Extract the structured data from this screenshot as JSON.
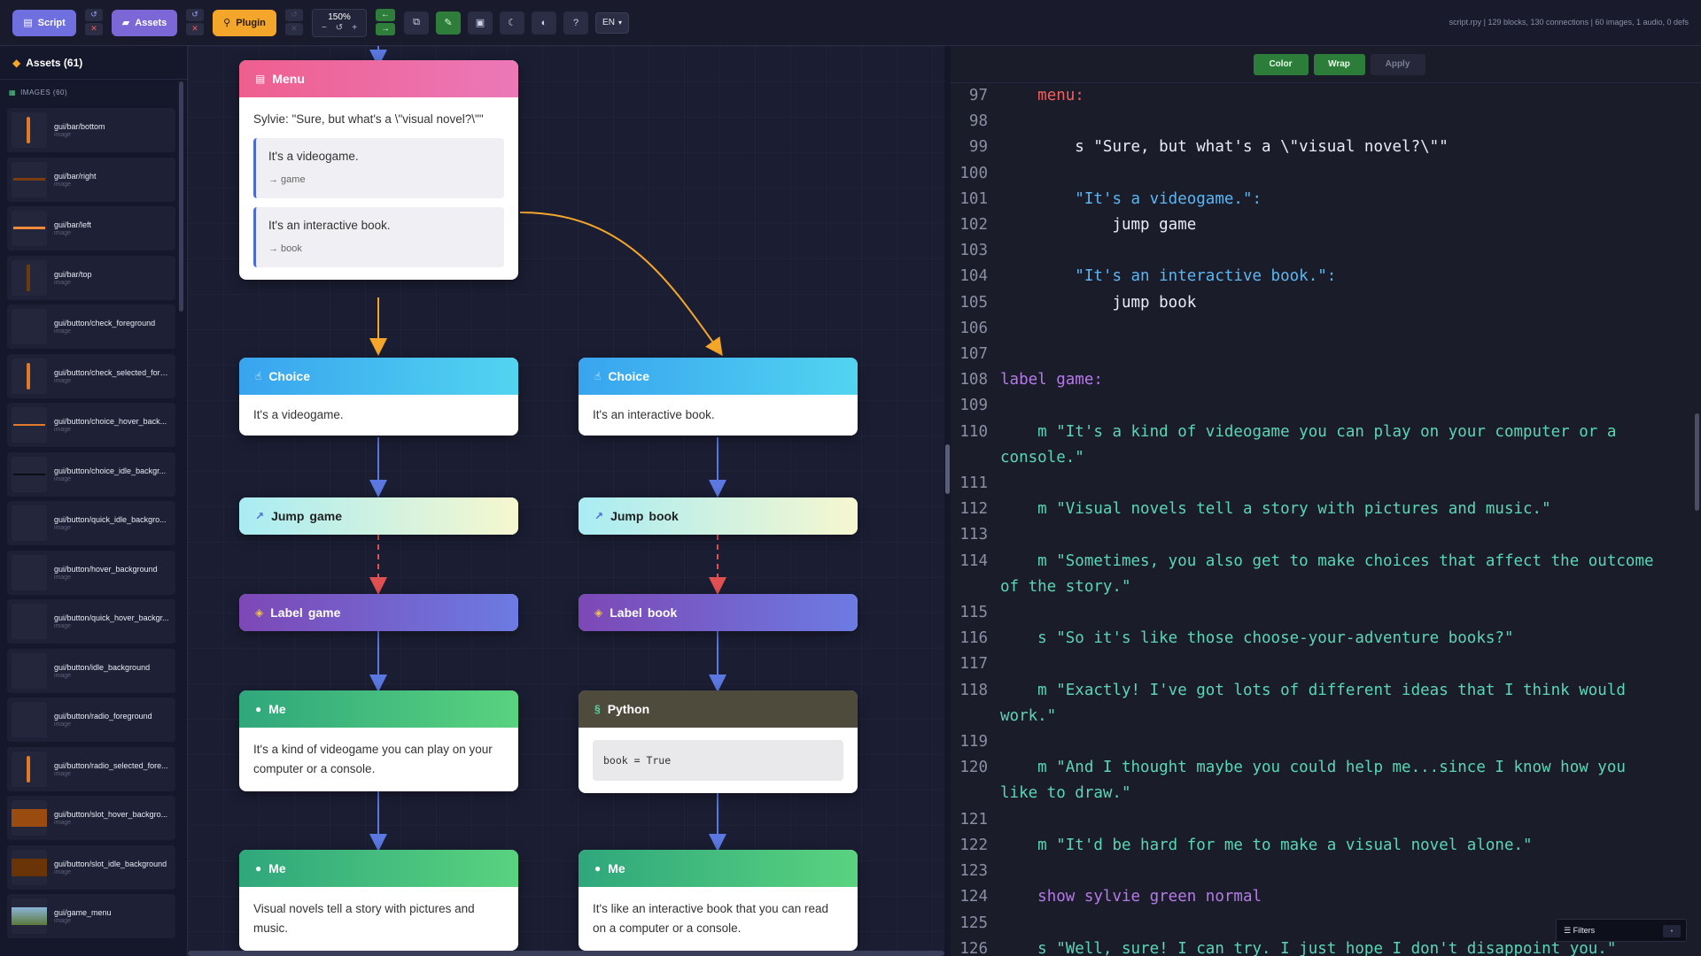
{
  "toolbar": {
    "script_label": "Script",
    "assets_label": "Assets",
    "plugin_label": "Plugin",
    "zoom": "150%",
    "zoom_minus": "−",
    "zoom_reset": "↺",
    "zoom_plus": "+",
    "lang": "EN",
    "help": "?",
    "status": "script.rpy | 129 blocks, 130 connections | 60 images, 1 audio, 0 defs"
  },
  "sidebar": {
    "title": "Assets (61)",
    "section": "IMAGES (60)",
    "assets": [
      {
        "name": "gui/bar/bottom",
        "type": "image"
      },
      {
        "name": "gui/bar/right",
        "type": "image"
      },
      {
        "name": "gui/bar/left",
        "type": "image"
      },
      {
        "name": "gui/bar/top",
        "type": "image"
      },
      {
        "name": "gui/button/check_foreground",
        "type": "image"
      },
      {
        "name": "gui/button/check_selected_fore...",
        "type": "image"
      },
      {
        "name": "gui/button/choice_hover_back...",
        "type": "image"
      },
      {
        "name": "gui/button/choice_idle_backgr...",
        "type": "image"
      },
      {
        "name": "gui/button/quick_idle_backgro...",
        "type": "image"
      },
      {
        "name": "gui/button/hover_background",
        "type": "image"
      },
      {
        "name": "gui/button/quick_hover_backgr...",
        "type": "image"
      },
      {
        "name": "gui/button/idle_background",
        "type": "image"
      },
      {
        "name": "gui/button/radio_foreground",
        "type": "image"
      },
      {
        "name": "gui/button/radio_selected_fore...",
        "type": "image"
      },
      {
        "name": "gui/button/slot_hover_backgro...",
        "type": "image"
      },
      {
        "name": "gui/button/slot_idle_background",
        "type": "image"
      },
      {
        "name": "gui/game_menu",
        "type": "image"
      }
    ]
  },
  "canvas": {
    "menu": {
      "title": "Menu",
      "prompt": "Sylvie: \"Sure, but what's a \\\"visual novel?\\\"\"",
      "options": [
        {
          "text": "It's a videogame.",
          "target": "→ game"
        },
        {
          "text": "It's an interactive book.",
          "target": "→ book"
        }
      ]
    },
    "choice_left": {
      "title": "Choice",
      "text": "It's a videogame."
    },
    "choice_right": {
      "title": "Choice",
      "text": "It's an interactive book."
    },
    "jump_left": {
      "title": "Jump",
      "target": "game"
    },
    "jump_right": {
      "title": "Jump",
      "target": "book"
    },
    "label_left": {
      "title": "Label",
      "target": "game"
    },
    "label_right": {
      "title": "Label",
      "target": "book"
    },
    "me_left_1": {
      "title": "Me",
      "text": "It's a kind of videogame you can play on your computer or a console."
    },
    "python_right": {
      "title": "Python",
      "code": "book = True"
    },
    "me_left_2": {
      "title": "Me",
      "text": "Visual novels tell a story with pictures and music."
    },
    "me_right": {
      "title": "Me",
      "text": "It's like an interactive book that you can read on a computer or a console."
    }
  },
  "editor": {
    "color_label": "Color",
    "wrap_label": "Wrap",
    "apply_label": "Apply",
    "filters_label": "☰ Filters",
    "lines": [
      {
        "n": "97",
        "t": "    menu:",
        "c": "k-menu"
      },
      {
        "n": "98",
        "t": "",
        "c": "k-plain"
      },
      {
        "n": "99",
        "t": "        s \"Sure, but what's a \\\"visual novel?\\\"\"",
        "c": "k-plain"
      },
      {
        "n": "100",
        "t": "",
        "c": "k-plain"
      },
      {
        "n": "101",
        "t": "        \"It's a videogame.\":",
        "c": "k-choice"
      },
      {
        "n": "102",
        "t": "            jump game",
        "c": "k-plain"
      },
      {
        "n": "103",
        "t": "",
        "c": "k-plain"
      },
      {
        "n": "104",
        "t": "        \"It's an interactive book.\":",
        "c": "k-choice"
      },
      {
        "n": "105",
        "t": "            jump book",
        "c": "k-plain"
      },
      {
        "n": "106",
        "t": "",
        "c": "k-plain"
      },
      {
        "n": "107",
        "t": "",
        "c": "k-plain"
      },
      {
        "n": "108",
        "t": "label game:",
        "c": "k-label"
      },
      {
        "n": "109",
        "t": "",
        "c": "k-plain"
      },
      {
        "n": "110",
        "t": "    m \"It's a kind of videogame you can play on your computer or a console.\"",
        "c": "k-str"
      },
      {
        "n": "111",
        "t": "",
        "c": "k-plain"
      },
      {
        "n": "112",
        "t": "    m \"Visual novels tell a story with pictures and music.\"",
        "c": "k-str"
      },
      {
        "n": "113",
        "t": "",
        "c": "k-plain"
      },
      {
        "n": "114",
        "t": "    m \"Sometimes, you also get to make choices that affect the outcome of the story.\"",
        "c": "k-str"
      },
      {
        "n": "115",
        "t": "",
        "c": "k-plain"
      },
      {
        "n": "116",
        "t": "    s \"So it's like those choose-your-adventure books?\"",
        "c": "k-str"
      },
      {
        "n": "117",
        "t": "",
        "c": "k-plain"
      },
      {
        "n": "118",
        "t": "    m \"Exactly! I've got lots of different ideas that I think would work.\"",
        "c": "k-str"
      },
      {
        "n": "119",
        "t": "",
        "c": "k-plain"
      },
      {
        "n": "120",
        "t": "    m \"And I thought maybe you could help me...since I know how you like to draw.\"",
        "c": "k-str"
      },
      {
        "n": "121",
        "t": "",
        "c": "k-plain"
      },
      {
        "n": "122",
        "t": "    m \"It'd be hard for me to make a visual novel alone.\"",
        "c": "k-str"
      },
      {
        "n": "123",
        "t": "",
        "c": "k-plain"
      },
      {
        "n": "124",
        "t": "    show sylvie green normal",
        "c": "k-show"
      },
      {
        "n": "125",
        "t": "",
        "c": "k-plain"
      },
      {
        "n": "126",
        "t": "    s \"Well, sure! I can try. I just hope I don't disappoint you.\"",
        "c": "k-str"
      }
    ]
  }
}
